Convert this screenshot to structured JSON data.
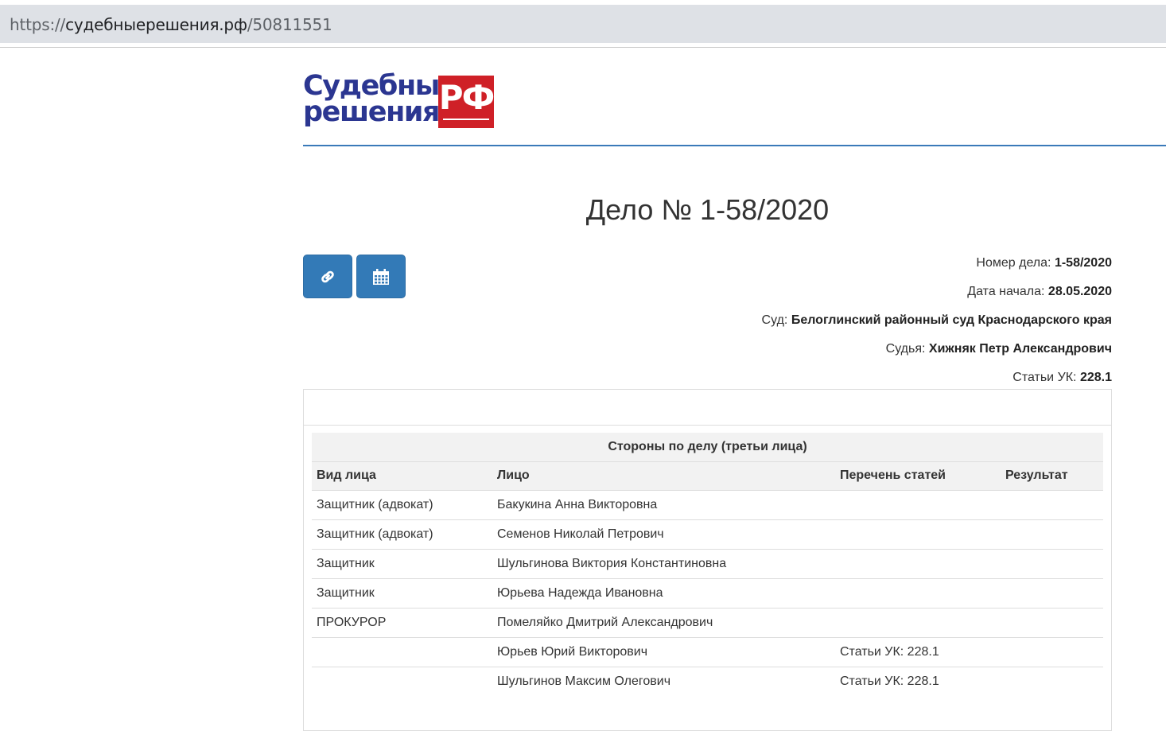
{
  "browser": {
    "url_scheme": "https://",
    "url_host": "судебныерешения.рф",
    "url_path": "/50811551"
  },
  "logo": {
    "line1": "Судебные",
    "line2": "решения",
    "badge": "РФ",
    "brand_blue": "#2b3691",
    "brand_red": "#cf2027"
  },
  "page_title": "Дело № 1-58/2020",
  "buttons": {
    "link_icon": "link-icon",
    "calendar_icon": "calendar-icon",
    "color": "#337ab7"
  },
  "case_meta": {
    "number_label": "Номер дела:",
    "number_value": "1-58/2020",
    "start_label": "Дата начала:",
    "start_value": "28.05.2020",
    "court_label": "Суд:",
    "court_value": "Белоглинский районный суд Краснодарского края",
    "judge_label": "Судья:",
    "judge_value": "Хижняк Петр Александрович",
    "articles_label": "Статьи УК:",
    "articles_value": "228.1"
  },
  "parties": {
    "caption": "Стороны по делу (третьи лица)",
    "headers": [
      "Вид лица",
      "Лицо",
      "Перечень статей",
      "Результат"
    ],
    "rows": [
      [
        "Защитник (адвокат)",
        "Бакукина Анна Викторовна",
        "",
        ""
      ],
      [
        "Защитник (адвокат)",
        "Семенов Николай Петрович",
        "",
        ""
      ],
      [
        "Защитник",
        "Шульгинова Виктория Константиновна",
        "",
        ""
      ],
      [
        "Защитник",
        "Юрьева Надежда Ивановна",
        "",
        ""
      ],
      [
        "ПРОКУРОР",
        "Помеляйко Дмитрий Александрович",
        "",
        ""
      ],
      [
        "",
        "Юрьев Юрий Викторович",
        "Статьи УК: 228.1",
        ""
      ],
      [
        "",
        "Шульгинов Максим Олегович",
        "Статьи УК: 228.1",
        ""
      ]
    ]
  }
}
